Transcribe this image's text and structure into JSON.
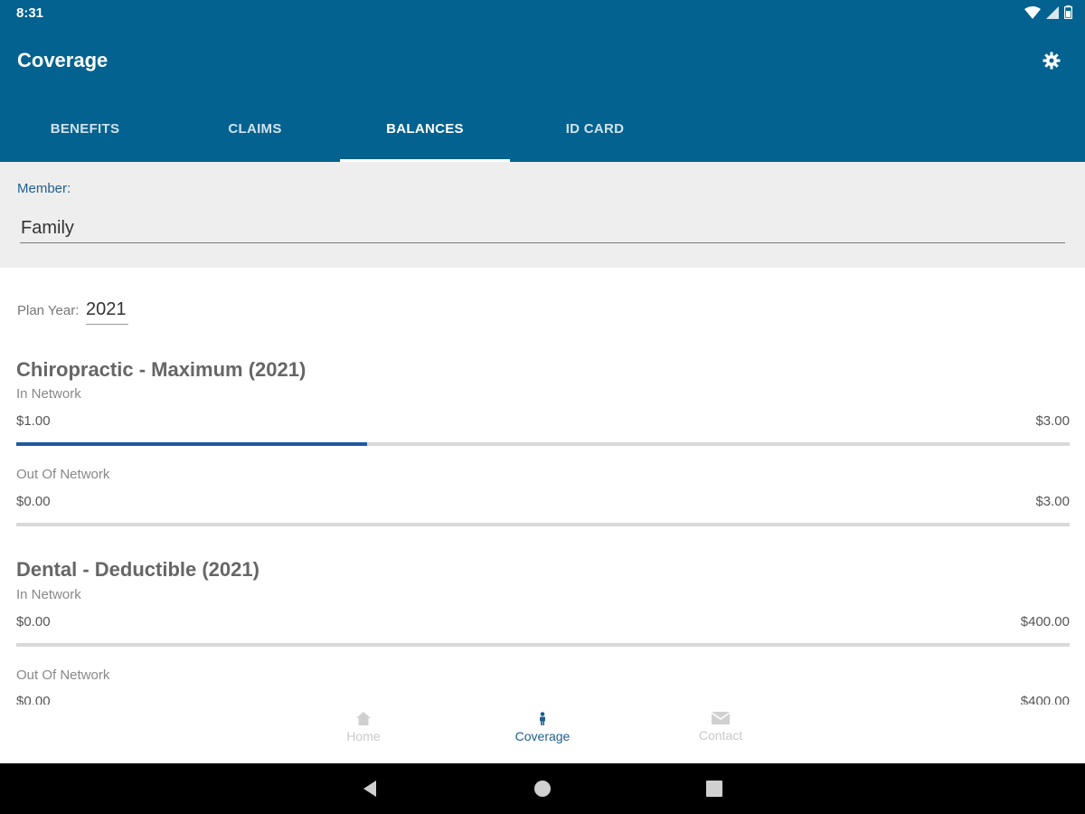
{
  "status_bar": {
    "time": "8:31"
  },
  "app_bar": {
    "title": "Coverage",
    "settings_icon": "gear-icon",
    "color": "#03628f"
  },
  "tabs": [
    {
      "label": "BENEFITS",
      "active": false
    },
    {
      "label": "CLAIMS",
      "active": false
    },
    {
      "label": "BALANCES",
      "active": true
    },
    {
      "label": "ID CARD",
      "active": false
    }
  ],
  "member": {
    "label": "Member:",
    "value": "Family"
  },
  "plan_year": {
    "label": "Plan Year:",
    "value": "2021"
  },
  "sections": [
    {
      "title": "Chiropractic - Maximum (2021)",
      "rows": [
        {
          "network": "In Network",
          "used": "$1.00",
          "max": "$3.00",
          "progress": 0.333
        },
        {
          "network": "Out Of Network",
          "used": "$0.00",
          "max": "$3.00",
          "progress": 0
        }
      ]
    },
    {
      "title": "Dental - Deductible (2021)",
      "rows": [
        {
          "network": "In Network",
          "used": "$0.00",
          "max": "$400.00",
          "progress": 0
        },
        {
          "network": "Out Of Network",
          "used": "$0.00",
          "max": "$400.00",
          "progress": 0
        }
      ]
    }
  ],
  "bottom_nav": [
    {
      "label": "Home",
      "icon": "home-icon",
      "active": false
    },
    {
      "label": "Coverage",
      "icon": "coverage-icon",
      "active": true
    },
    {
      "label": "Contact",
      "icon": "mail-icon",
      "active": false
    }
  ],
  "colors": {
    "accent": "#1f5aa0",
    "primary": "#03628f"
  }
}
